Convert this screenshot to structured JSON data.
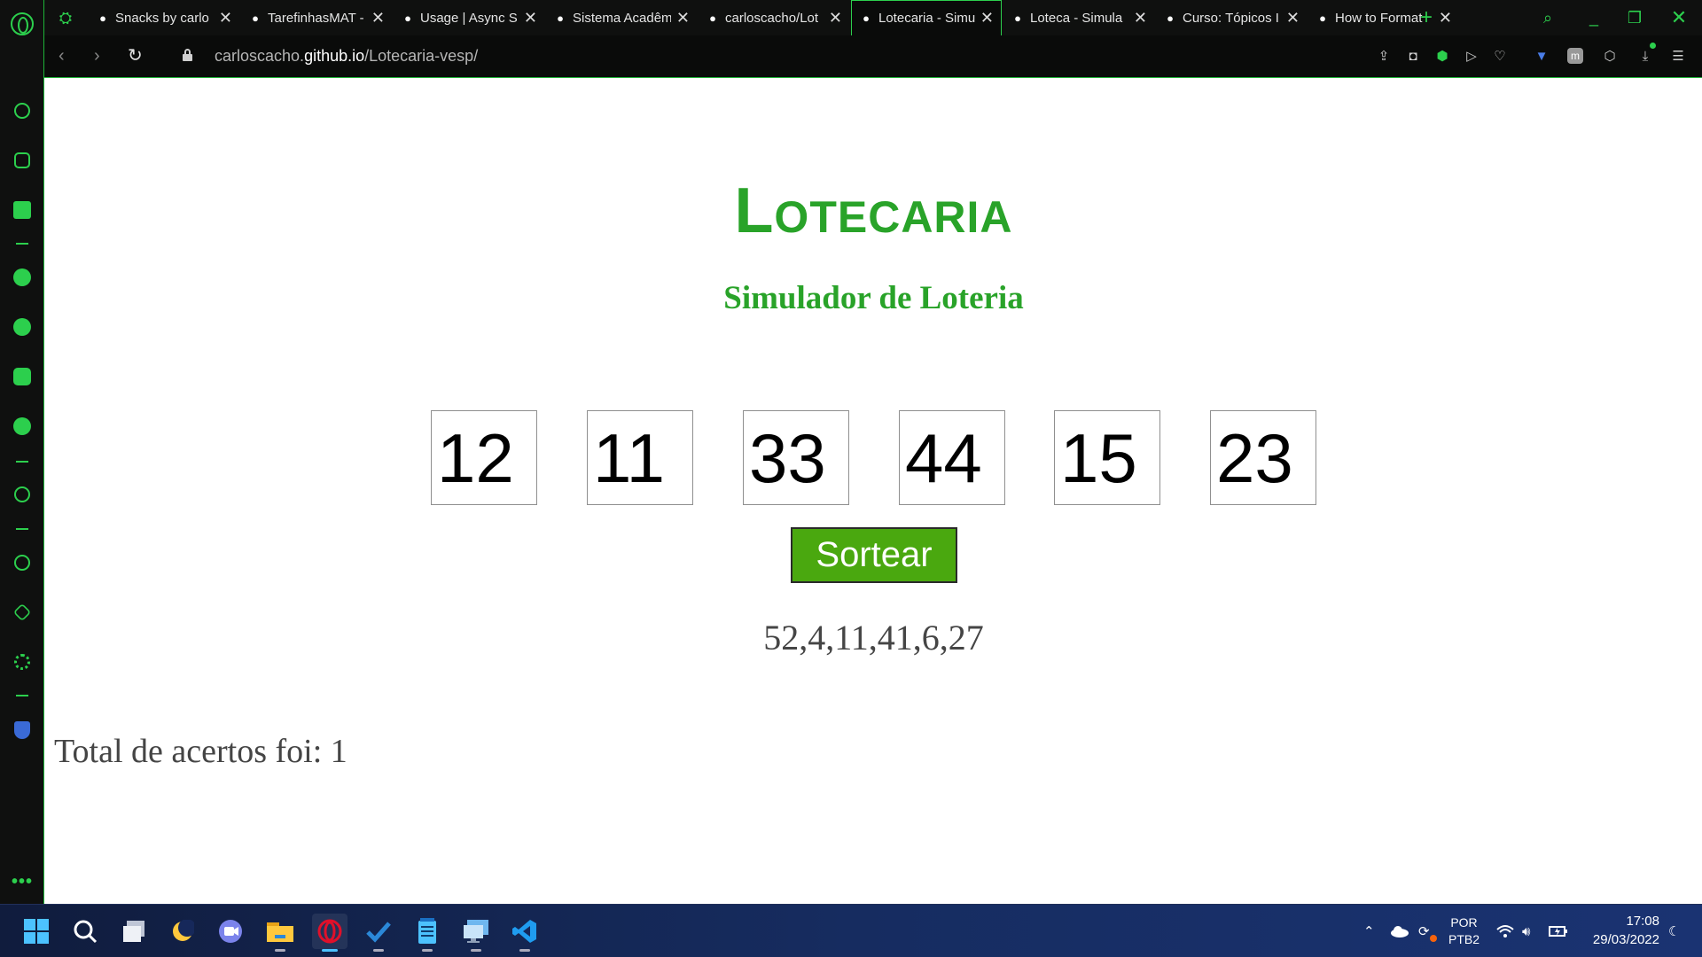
{
  "browser": {
    "tabs": [
      {
        "title": "Snacks by carlo",
        "icon": "a-logo-icon"
      },
      {
        "title": "TarefinhasMAT -",
        "icon": "puzzle-icon"
      },
      {
        "title": "Usage | Async S",
        "icon": "chest-icon"
      },
      {
        "title": "Sistema Acadêm",
        "icon": "grid-dots-icon"
      },
      {
        "title": "carloscacho/Lot",
        "icon": "github-icon"
      },
      {
        "title": "Lotecaria - Simu",
        "icon": "globe-icon",
        "active": true
      },
      {
        "title": "Loteca - Simula",
        "icon": "globe-icon"
      },
      {
        "title": "Curso: Tópicos I",
        "icon": "m-logo-icon"
      },
      {
        "title": "How to Format",
        "icon": "a-bracket-icon"
      }
    ],
    "url_prefix": "carloscacho.",
    "url_domain": "github.io",
    "url_path": "/Lotecaria-vesp/"
  },
  "page": {
    "title": "Lotecaria",
    "subtitle": "Simulador de Loteria",
    "numbers": [
      "12",
      "11",
      "33",
      "44",
      "15",
      "23"
    ],
    "draw_button": "Sortear",
    "drawn_numbers": "52,4,11,41,6,27",
    "total_text": "Total de acertos foi: 1"
  },
  "taskbar": {
    "lang_top": "POR",
    "lang_bottom": "PTB2",
    "time": "17:08",
    "date": "29/03/2022"
  },
  "colors": {
    "accent": "#2ccf4d",
    "heading": "#29a329",
    "button": "#4aa80f",
    "text": "#454545"
  }
}
